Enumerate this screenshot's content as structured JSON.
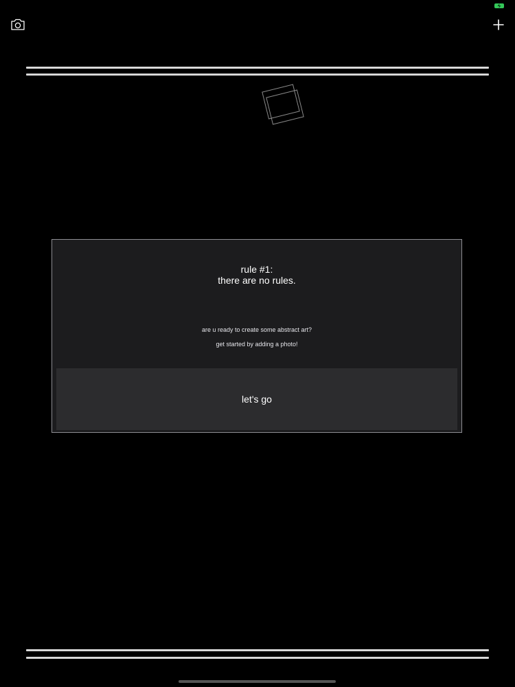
{
  "status_bar": {
    "battery_icon": "battery-charging-icon",
    "battery_color": "#34c759"
  },
  "toolbar": {
    "camera_icon": "camera-icon",
    "add_icon": "plus-icon"
  },
  "decor": {
    "top_icon": "stacked-frames-icon",
    "line_color": "#d8d8d8"
  },
  "dialog": {
    "title_line1": "rule #1:",
    "title_line2": "there are no rules.",
    "text1": "are u ready to create some abstract art?",
    "text2": "get started by adding a photo!",
    "button_label": "let's go"
  }
}
